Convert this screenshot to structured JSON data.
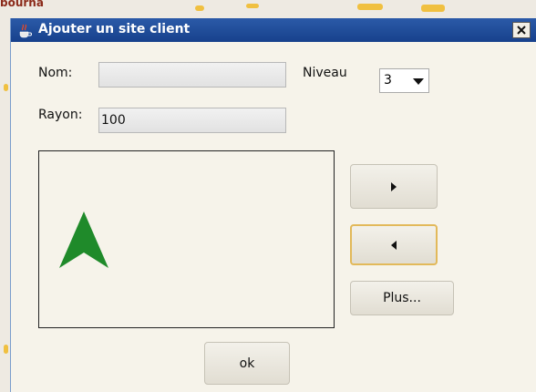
{
  "background": {
    "partial_text": "bourna"
  },
  "dialog": {
    "title": "Ajouter un site client",
    "title_icon": "java-cup-icon",
    "close_icon": "close-icon"
  },
  "form": {
    "nom_label": "Nom:",
    "nom_value": "",
    "niveau_label": "Niveau",
    "niveau_selected": "3",
    "rayon_label": "Rayon:",
    "rayon_value": "100"
  },
  "preview": {
    "shape": "arrow-up",
    "color": "#1f8a2a"
  },
  "buttons": {
    "next_icon": "triangle-right-icon",
    "prev_icon": "triangle-left-icon",
    "plus_label": "Plus...",
    "ok_label": "ok"
  },
  "colors": {
    "titlebar": "#1f4fa0",
    "window_bg": "#f6f3ea",
    "focus_border": "#e2b95a"
  }
}
